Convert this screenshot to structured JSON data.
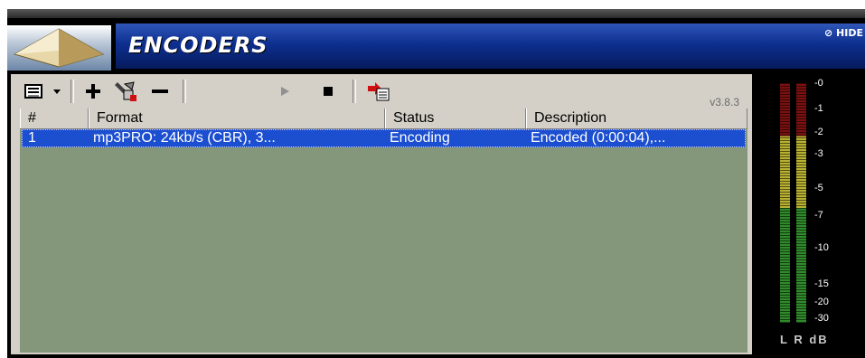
{
  "header": {
    "title": "ENCODERS",
    "hide_label": "⊘ HIDE"
  },
  "toolbar": {
    "version": "v3.8.3",
    "buttons": [
      {
        "name": "encoder-menu",
        "glyph": "▤"
      },
      {
        "name": "dropdown",
        "glyph": "▾"
      },
      {
        "name": "add",
        "glyph": "+"
      },
      {
        "name": "configure",
        "glyph": "✎"
      },
      {
        "name": "remove",
        "glyph": "—"
      },
      {
        "name": "play",
        "glyph": "▶"
      },
      {
        "name": "stop",
        "glyph": "■"
      },
      {
        "name": "export",
        "glyph": "⎘"
      }
    ]
  },
  "list": {
    "columns": [
      "#",
      "Format",
      "Status",
      "Description"
    ],
    "rows": [
      {
        "num": "1",
        "format": "mp3PRO: 24kb/s (CBR), 3...",
        "status": "Encoding",
        "description": "Encoded (0:00:04),..."
      }
    ]
  },
  "meter": {
    "scale": [
      "-0",
      "-1",
      "-2",
      "-3",
      "-5",
      "-7",
      "-10",
      "-15",
      "-20",
      "-30"
    ],
    "footer": "L R dB",
    "colors": {
      "green": "#2f8a2a",
      "yellow": "#b8b030",
      "red": "#7a1010"
    }
  },
  "colors": {
    "title_bar": "#0d2f8f",
    "panel": "#d4d0c8",
    "list_bg": "#85977b",
    "selection": "#1c4fd0"
  }
}
